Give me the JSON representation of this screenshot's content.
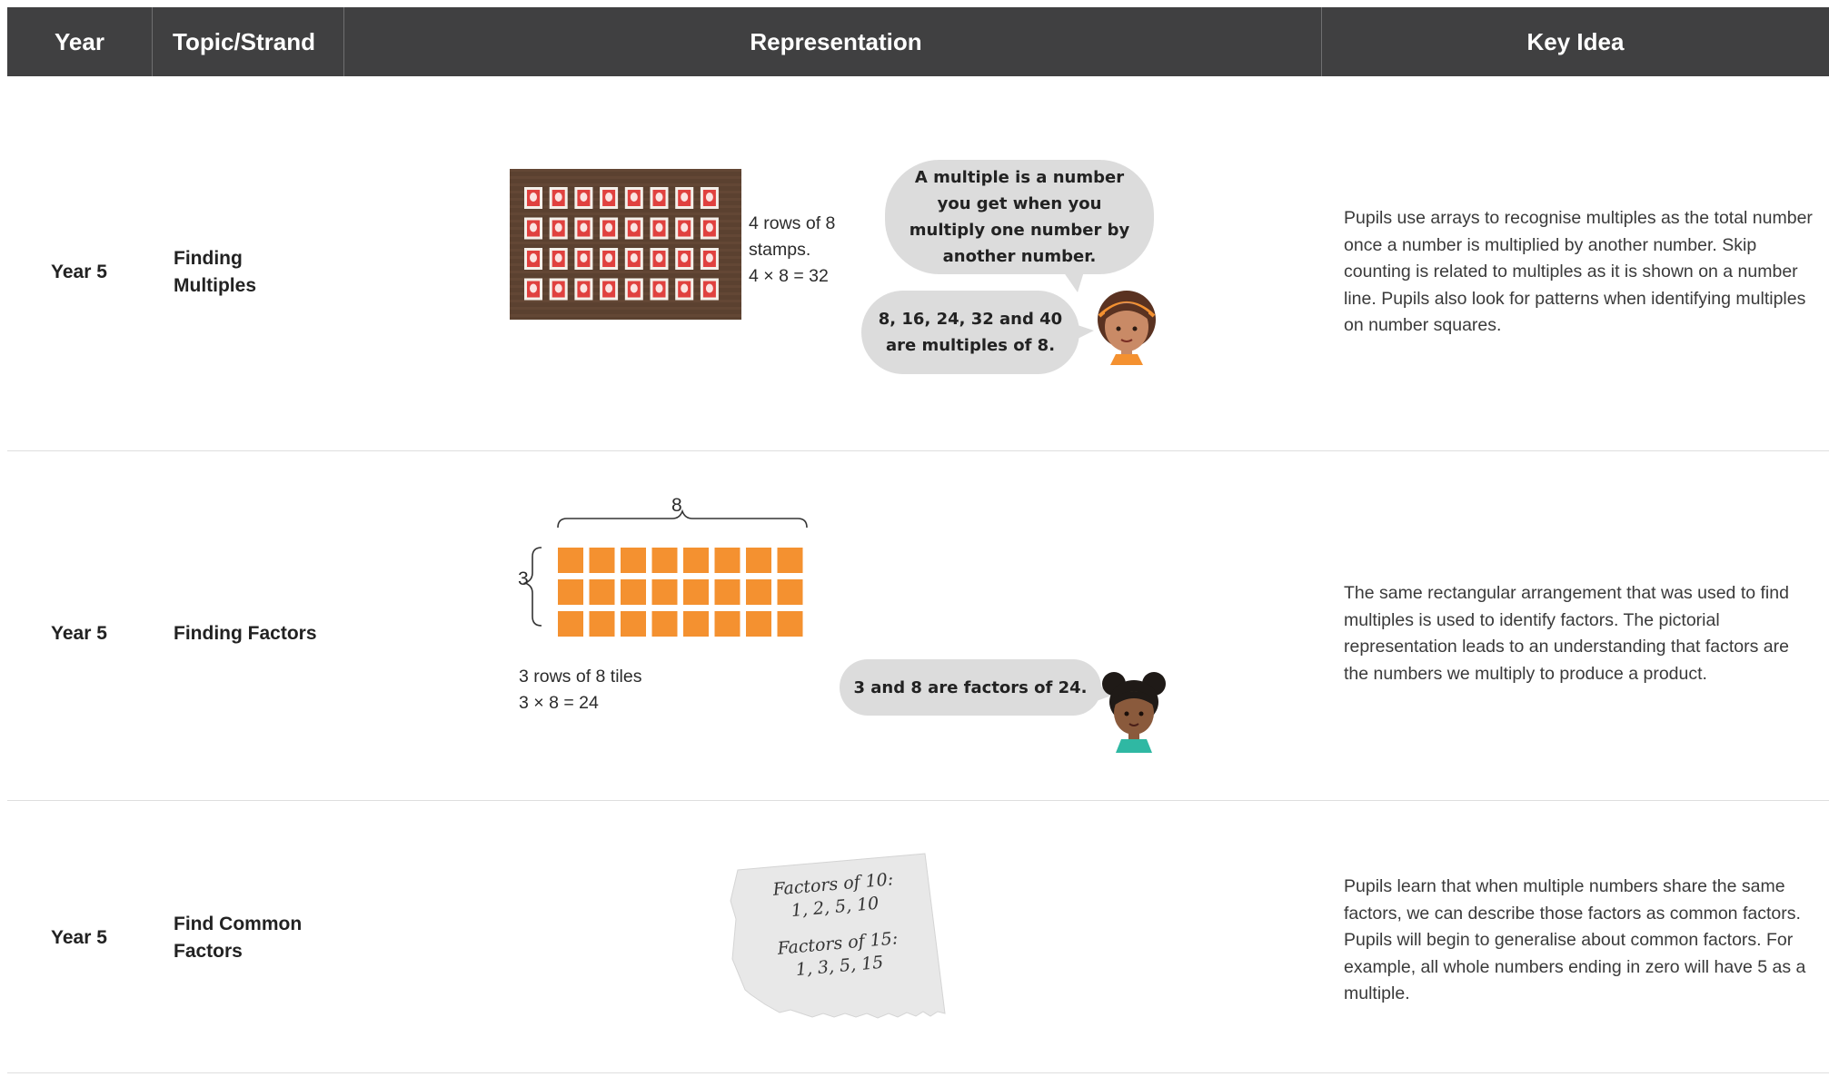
{
  "header": {
    "year": "Year",
    "topic": "Topic/Strand",
    "representation": "Representation",
    "key_idea": "Key Idea"
  },
  "rows": [
    {
      "year": "Year 5",
      "topic": "Finding Multiples",
      "caption": [
        "4 rows of 8",
        "stamps.",
        "4 × 8 = 32"
      ],
      "bubbles": [
        "A multiple is a number you get when you multiply one number by another number.",
        "8, 16, 24, 32 and 40 are multiples of 8."
      ],
      "key_idea": "Pupils use arrays to recognise multiples as the total number once a number is multiplied by another number. Skip counting is related to multiples as it is shown on a number line. Pupils also look for patterns when identifying multiples on number squares."
    },
    {
      "year": "Year 5",
      "topic": "Finding Factors",
      "label_top": "8",
      "label_left": "3",
      "caption": [
        "3 rows of 8 tiles",
        "3 × 8 = 24"
      ],
      "bubbles": [
        "3 and 8 are factors of 24."
      ],
      "key_idea": "The same rectangular arrangement that was used to find multiples is used to identify factors. The pictorial representation leads to an understanding that factors are the numbers we multiply to produce a product."
    },
    {
      "year": "Year 5",
      "topic": "Find Common Factors",
      "note": [
        "Factors of 10:",
        "1, 2, 5, 10",
        "Factors of 15:",
        "1, 3, 5, 15"
      ],
      "key_idea": "Pupils learn that when multiple numbers share the same factors, we can describe those factors as common factors. Pupils will begin to generalise about common factors. For example, all whole numbers ending in zero will have 5 as a multiple."
    }
  ],
  "colors": {
    "header_bg": "#404041",
    "tile_orange": "#f49130",
    "stamp_board": "#5b4130",
    "stamp_red": "#e0413f",
    "bubble_grey": "#dcdcdc"
  }
}
